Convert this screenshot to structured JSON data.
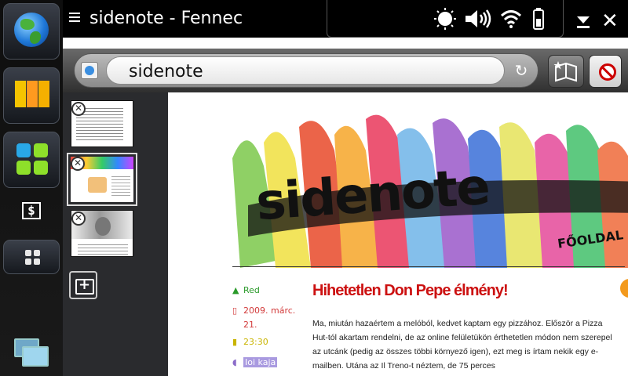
{
  "window": {
    "title": "sidenote - Fennec",
    "close_glyph": "✕"
  },
  "status_icons": [
    "brightness-icon",
    "volume-icon",
    "wifi-icon",
    "battery-icon"
  ],
  "dock": {
    "items": [
      "browser-globe-icon",
      "contacts-icon",
      "applications-icon",
      "terminal-icon",
      "dashboard-icon",
      "task-switcher-icon"
    ],
    "terminal_label": "$"
  },
  "url_bar": {
    "value": "sidenote",
    "reload_glyph": "↻"
  },
  "tabs": {
    "count": 3,
    "close_glyph": "✕",
    "selected_index": 1
  },
  "page": {
    "banner_text": "sidenote",
    "banner_nav": "FŐOLDAL",
    "post": {
      "author": "Red",
      "date": "2009. márc.",
      "day": "21.",
      "time": "23:30",
      "tag": "Ioi kaja",
      "title": "Hihetetlen Don Pepe élmény!",
      "body": "Ma, miután hazaértem a melóból, kedvet kaptam egy pizzához. Először a Pizza Hut-tól akartam rendelni, de az online felületükön érthetetlen módon nem szerepel az utcánk (pedig az összes többi környező igen), ezt meg is írtam nekik egy e-mailben. Utána az Il Treno-t néztem, de 75 perces"
    }
  },
  "colors": {
    "post_title": "#cc1111",
    "author": "#2a9a2a",
    "date": "#d23a3a",
    "time": "#c9b400",
    "tag": "#8b6cc9"
  }
}
